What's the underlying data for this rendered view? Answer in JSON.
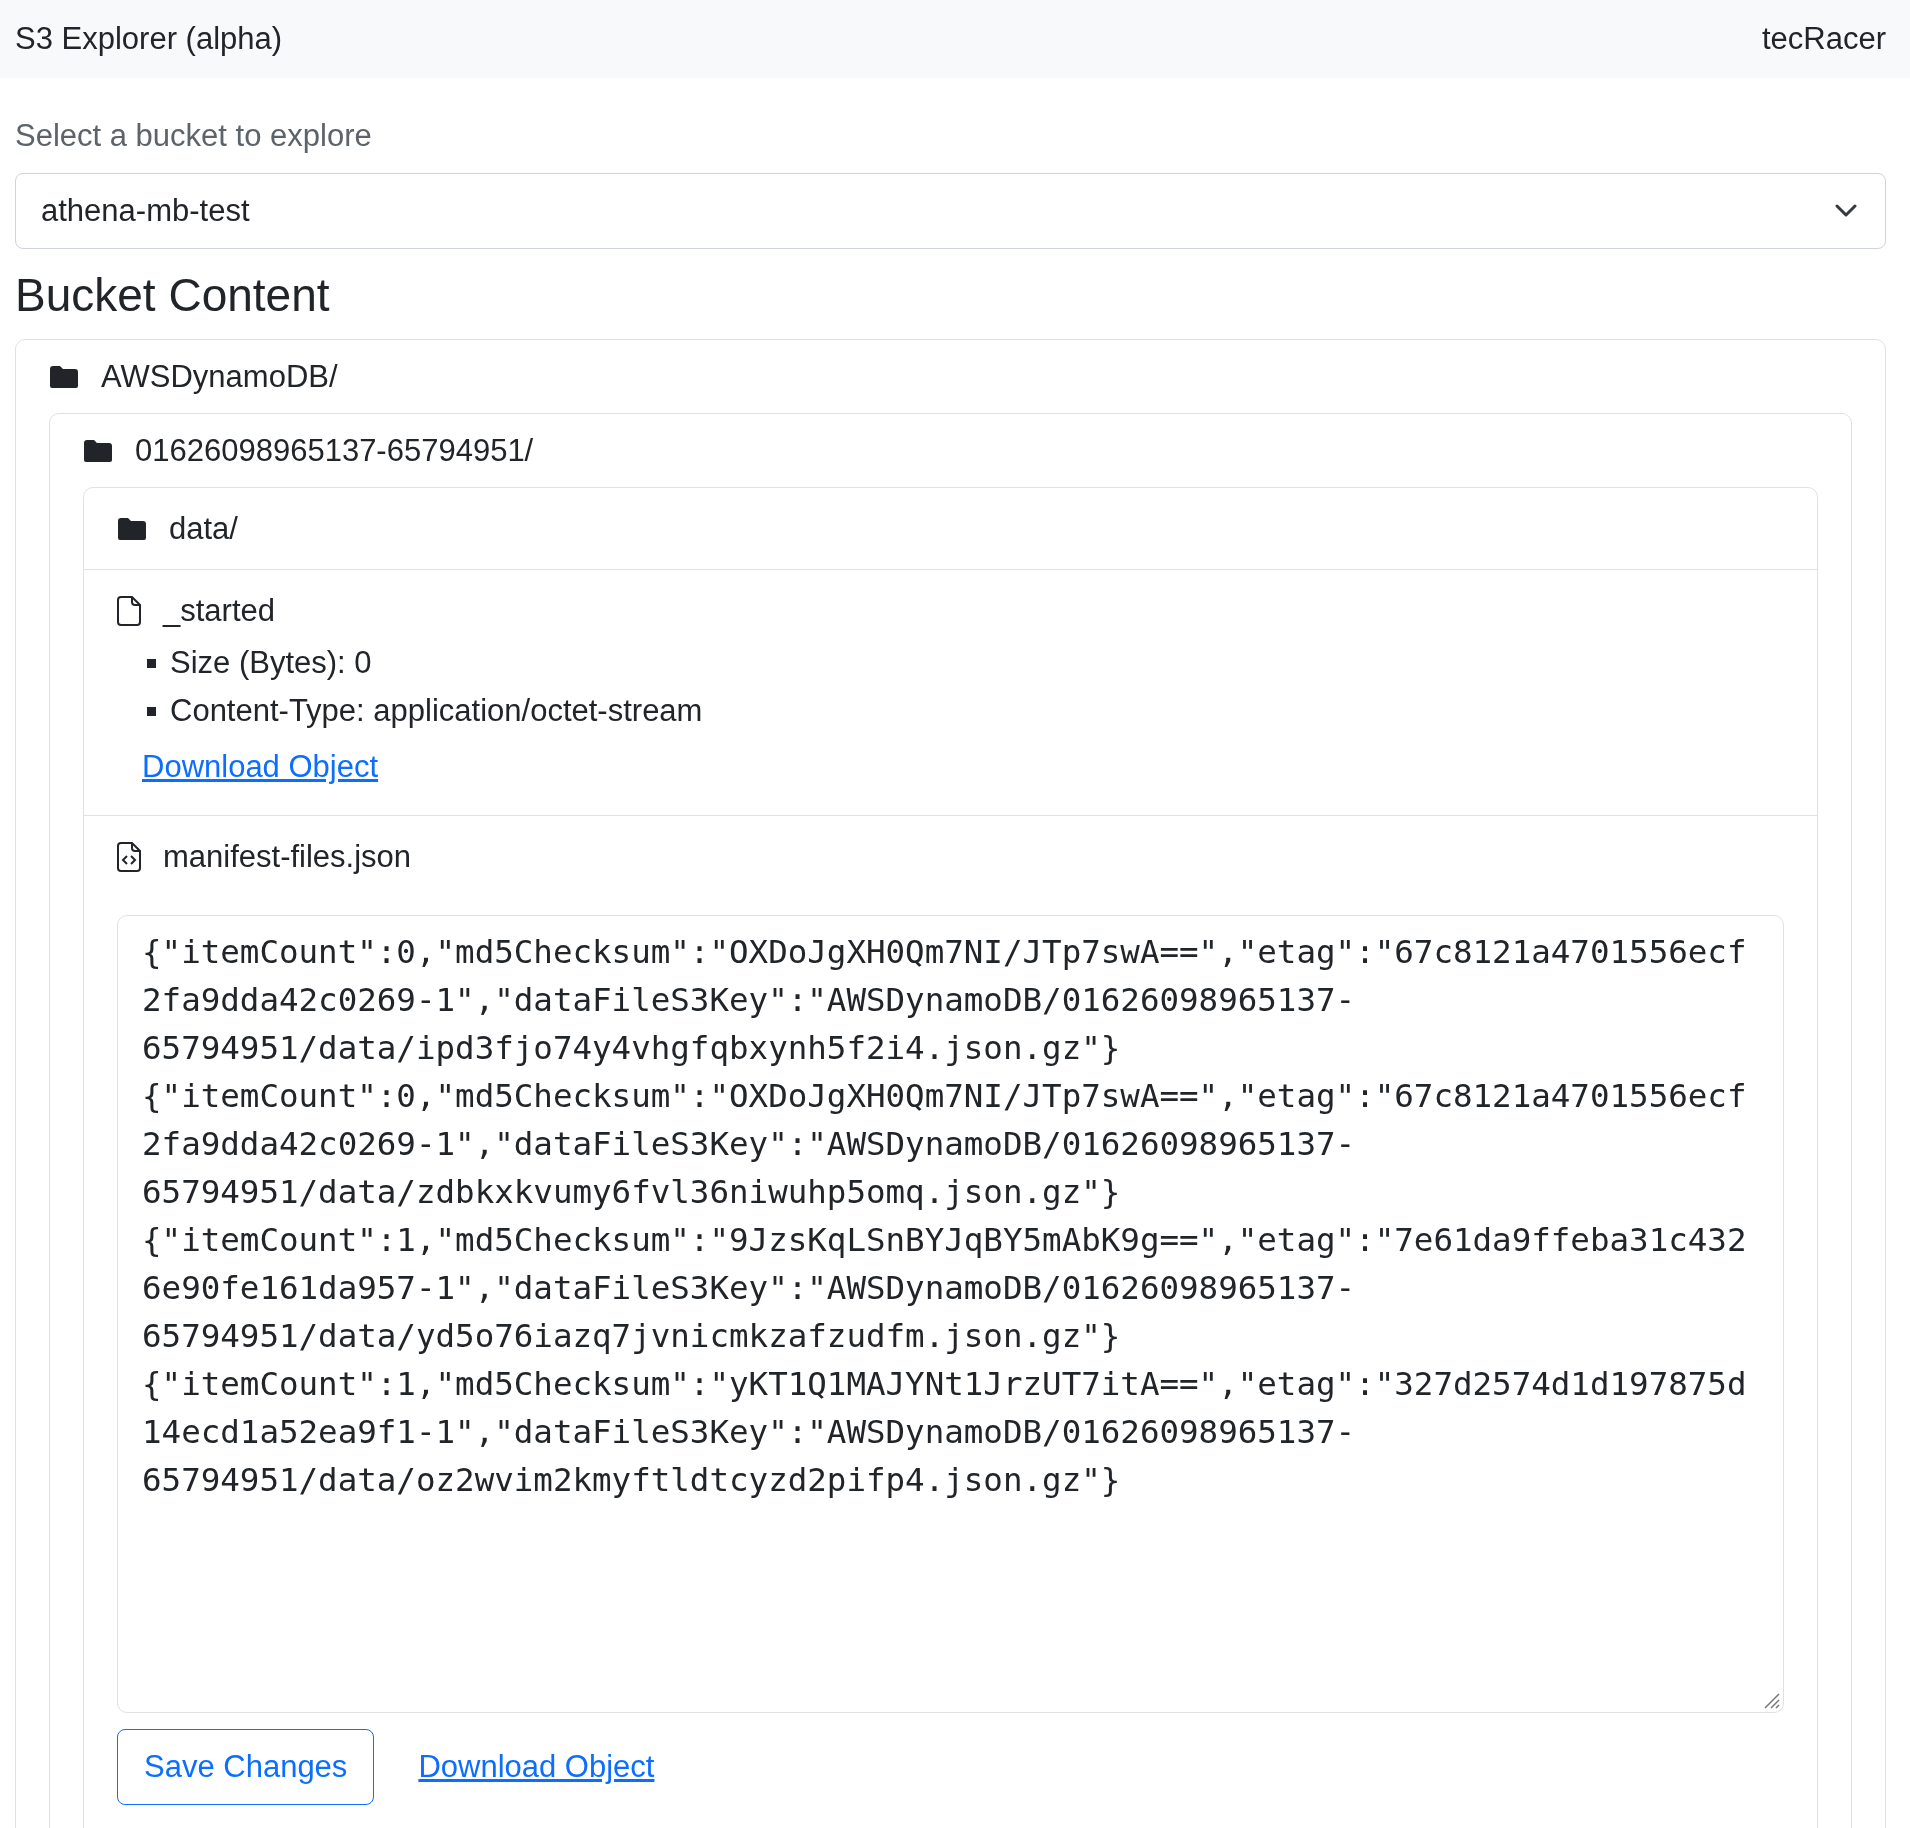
{
  "header": {
    "title": "S3 Explorer (alpha)",
    "brand": "tecRacer"
  },
  "bucket_select": {
    "label": "Select a bucket to explore",
    "value": "athena-mb-test"
  },
  "content_heading": "Bucket Content",
  "tree": [
    {
      "kind": "folder",
      "name": "AWSDynamoDB/",
      "children": [
        {
          "kind": "folder",
          "name": "01626098965137-65794951/",
          "children": [
            {
              "kind": "folder",
              "name": "data/"
            },
            {
              "kind": "file",
              "name": "_started",
              "details": [
                "Size (Bytes): 0",
                "Content-Type: application/octet-stream"
              ],
              "link": "Download Object"
            },
            {
              "kind": "code_file",
              "name": "manifest-files.json",
              "editor": {
                "content": "{\"itemCount\":0,\"md5Checksum\":\"OXDoJgXH0Qm7NI/JTp7swA==\",\"etag\":\"67c8121a4701556ecf2fa9dda42c0269-1\",\"dataFileS3Key\":\"AWSDynamoDB/01626098965137-65794951/data/ipd3fjo74y4vhgfqbxynh5f2i4.json.gz\"}\n{\"itemCount\":0,\"md5Checksum\":\"OXDoJgXH0Qm7NI/JTp7swA==\",\"etag\":\"67c8121a4701556ecf2fa9dda42c0269-1\",\"dataFileS3Key\":\"AWSDynamoDB/01626098965137-65794951/data/zdbkxkvumy6fvl36niwuhp5omq.json.gz\"}\n{\"itemCount\":1,\"md5Checksum\":\"9JzsKqLSnBYJqBY5mAbK9g==\",\"etag\":\"7e61da9ffeba31c4326e90fe161da957-1\",\"dataFileS3Key\":\"AWSDynamoDB/01626098965137-65794951/data/yd5o76iazq7jvnicmkzafzudfm.json.gz\"}\n{\"itemCount\":1,\"md5Checksum\":\"yKT1Q1MAJYNt1JrzUT7itA==\",\"etag\":\"327d2574d1d197875d14ecd1a52ea9f1-1\",\"dataFileS3Key\":\"AWSDynamoDB/01626098965137-65794951/data/oz2wvim2kmyftldtcyzd2pifp4.json.gz\"}"
              },
              "save_label": "Save Changes",
              "link": "Download Object"
            }
          ]
        }
      ]
    }
  ]
}
